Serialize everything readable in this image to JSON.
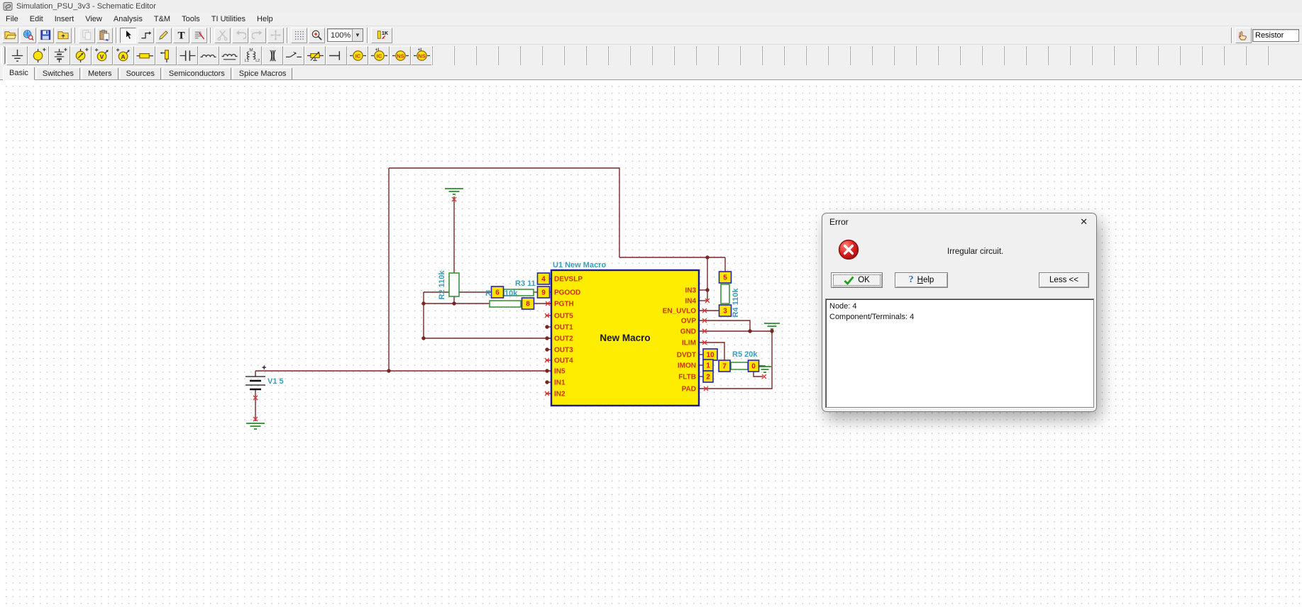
{
  "window": {
    "title": "Simulation_PSU_3v3 - Schematic Editor"
  },
  "menu": {
    "items": [
      "File",
      "Edit",
      "Insert",
      "View",
      "Analysis",
      "T&M",
      "Tools",
      "TI Utilities",
      "Help"
    ]
  },
  "toolbar_main": {
    "groups": [
      {
        "items": [
          {
            "icon": "open-file"
          },
          {
            "icon": "open-url"
          },
          {
            "icon": "save"
          },
          {
            "icon": "open-folder"
          }
        ]
      },
      {
        "items": [
          {
            "icon": "copy",
            "disabled": true
          },
          {
            "icon": "paste"
          }
        ]
      },
      {
        "items": [
          {
            "icon": "cursor",
            "active": true
          },
          {
            "icon": "wire"
          },
          {
            "icon": "pencil"
          },
          {
            "icon": "text"
          },
          {
            "icon": "delete"
          }
        ]
      },
      {
        "items": [
          {
            "icon": "cut",
            "disabled": true
          },
          {
            "icon": "undo",
            "disabled": true
          },
          {
            "icon": "redo",
            "disabled": true
          },
          {
            "icon": "move",
            "disabled": true
          }
        ]
      },
      {
        "items": [
          {
            "icon": "grid"
          },
          {
            "icon": "zoom-in"
          }
        ]
      }
    ],
    "zoom_value": "100%",
    "value_tool_icon": "value-label",
    "search_icon": "find-component",
    "component_search": "Resistor"
  },
  "component_tabs": {
    "items": [
      "Basic",
      "Switches",
      "Meters",
      "Sources",
      "Semiconductors",
      "Spice Macros"
    ],
    "active": "Basic"
  },
  "component_palette": [
    "ground",
    "voltage-source",
    "battery",
    "current-source",
    "voltage-meter",
    "current-meter",
    "resistor",
    "current-arrow",
    "capacitor",
    "inductor",
    "inductor-core",
    "coupled-inductors",
    "transformer",
    "switch",
    "potentiometer",
    "terminal",
    "ic-macro",
    "ic-macro-plus",
    "ns-macro",
    "ns-macro-plus"
  ],
  "schematic": {
    "ic": {
      "refdes_label": "U1 New Macro",
      "body_label": "New Macro",
      "left_pins": [
        "DEVSLP",
        "PGOOD",
        "PGTH",
        "OUT5",
        "OUT1",
        "OUT2",
        "OUT3",
        "OUT4",
        "IN5",
        "IN1",
        "IN2"
      ],
      "right_pins": [
        "IN3",
        "IN4",
        "EN_UVLO",
        "OVP",
        "GND",
        "ILIM",
        "DVDT",
        "IMON",
        "FLTB",
        "PAD"
      ]
    },
    "labels": {
      "v1": "V1 5",
      "r2": "R2 110k",
      "r3": "R3 11",
      "r1_name": "R",
      "r1_value": "10k",
      "r4": "R4 110k",
      "r5": "R5 20k",
      "plus_sign": "+"
    },
    "node_boxes": [
      "4",
      "9",
      "8",
      "6",
      "5",
      "3",
      "10",
      "1",
      "2",
      "7",
      "0"
    ]
  },
  "error_dialog": {
    "title": "Error",
    "message": "Irregular circuit.",
    "ok_label": "OK",
    "help_label": "Help",
    "less_label": "Less <<",
    "details": [
      "Node: 4",
      "Component/Terminals: 4"
    ]
  }
}
